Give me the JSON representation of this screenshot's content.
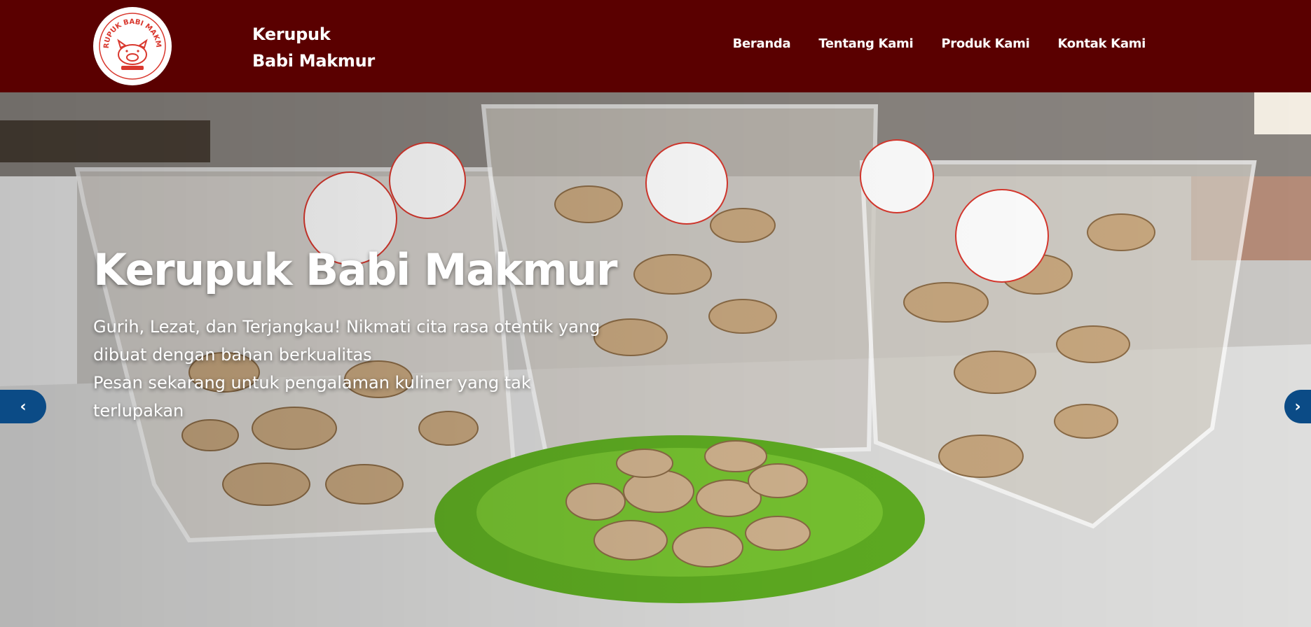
{
  "header": {
    "brand_line1": "Kerupuk",
    "brand_line2": "Babi Makmur",
    "logo_text": "KERUPUK BABI MAKMUR",
    "nav": [
      {
        "label": "Beranda"
      },
      {
        "label": "Tentang Kami"
      },
      {
        "label": "Produk Kami"
      },
      {
        "label": "Kontak Kami"
      }
    ]
  },
  "hero": {
    "title": "Kerupuk Babi Makmur",
    "line1": "Gurih, Lezat, dan Terjangkau! Nikmati cita rasa otentik yang",
    "line2": "dibuat dengan bahan berkualitas",
    "line3": "Pesan sekarang untuk pengalaman kuliner yang tak",
    "line4": "terlupakan",
    "prev_icon": "chevron-left-icon",
    "next_icon": "chevron-right-icon"
  },
  "colors": {
    "header_bg": "#5a0000",
    "arrow_bg": "#0b4b86",
    "plate": "#6bb52d"
  }
}
